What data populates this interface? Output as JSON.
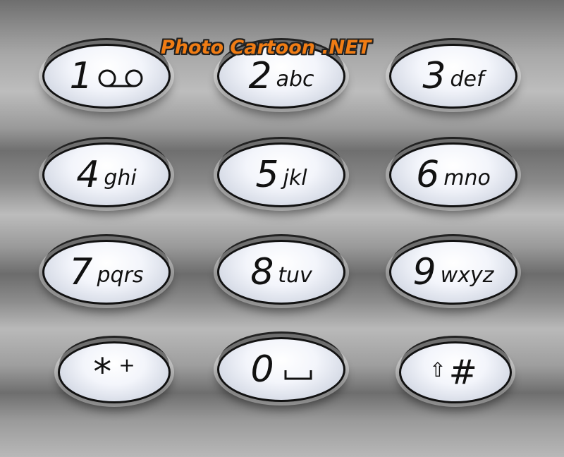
{
  "watermark": "Photo Cartoon .NET",
  "keys": [
    {
      "digit": "1",
      "letters": "",
      "icon": "voicemail-icon"
    },
    {
      "digit": "2",
      "letters": "abc"
    },
    {
      "digit": "3",
      "letters": "def"
    },
    {
      "digit": "4",
      "letters": "ghi"
    },
    {
      "digit": "5",
      "letters": "jkl"
    },
    {
      "digit": "6",
      "letters": "mno"
    },
    {
      "digit": "7",
      "letters": "pqrs"
    },
    {
      "digit": "8",
      "letters": "tuv"
    },
    {
      "digit": "9",
      "letters": "wxyz"
    },
    {
      "digit": "*",
      "letters": "+"
    },
    {
      "digit": "0",
      "letters": "",
      "icon": "space-icon"
    },
    {
      "digit": "#",
      "letters": "⇧"
    }
  ]
}
